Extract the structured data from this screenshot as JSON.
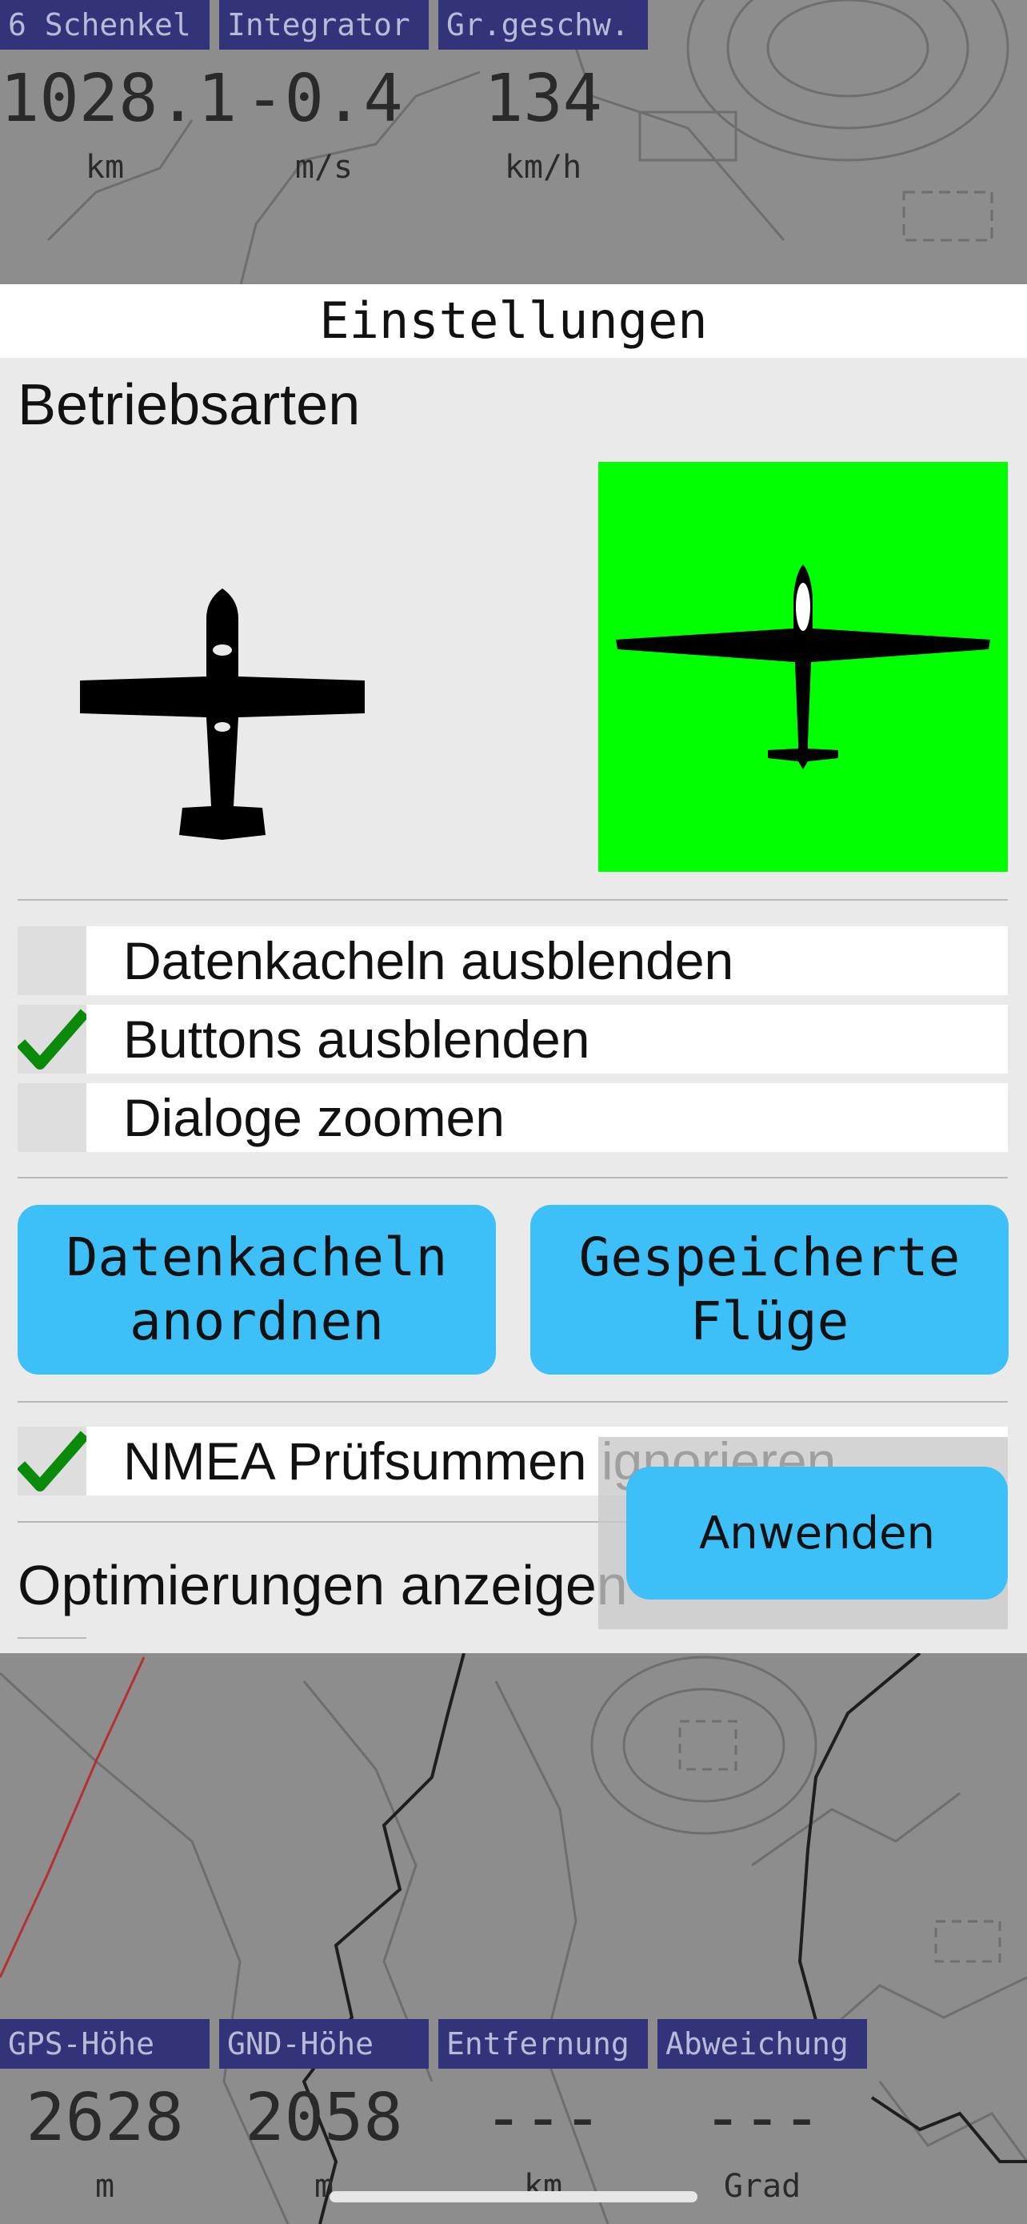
{
  "top_tiles": [
    {
      "label": "6 Schenkel",
      "value": "1028.1",
      "unit": "km"
    },
    {
      "label": "Integrator",
      "value": "-0.4",
      "unit": "m/s"
    },
    {
      "label": "Gr.geschw.",
      "value": "134",
      "unit": "km/h"
    }
  ],
  "bottom_tiles": [
    {
      "label": "GPS-Höhe",
      "value": "2628",
      "unit": "m"
    },
    {
      "label": "GND-Höhe",
      "value": "2058",
      "unit": "m"
    },
    {
      "label": "Entfernung",
      "value": "---",
      "unit": "km"
    },
    {
      "label": "Abweichung",
      "value": "---",
      "unit": "Grad"
    }
  ],
  "dialog": {
    "title": "Einstellungen",
    "section_heading": "Betriebsarten",
    "modes": [
      {
        "name": "motorflugzeug",
        "selected": false
      },
      {
        "name": "segelflugzeug",
        "selected": true,
        "highlight_color": "#00ff00"
      }
    ],
    "checkboxes": [
      {
        "label": "Datenkacheln ausblenden",
        "checked": false
      },
      {
        "label": "Buttons ausblenden",
        "checked": true
      },
      {
        "label": "Dialoge zoomen",
        "checked": false
      }
    ],
    "buttons": {
      "tiles": [
        "Datenkacheln",
        "anordnen"
      ],
      "flights": [
        "Gespeicherte",
        "Flüge"
      ]
    },
    "nmea": {
      "label": "NMEA Prüfsummen ignorieren",
      "checked": true
    },
    "optimizations_label": "Optimierungen anzeigen",
    "apply_label": "Anwenden"
  },
  "colors": {
    "accent": "#3dbff8",
    "check": "#0a8a0a",
    "tile_label_bg": "#33337a",
    "selected_mode": "#00ff00"
  }
}
